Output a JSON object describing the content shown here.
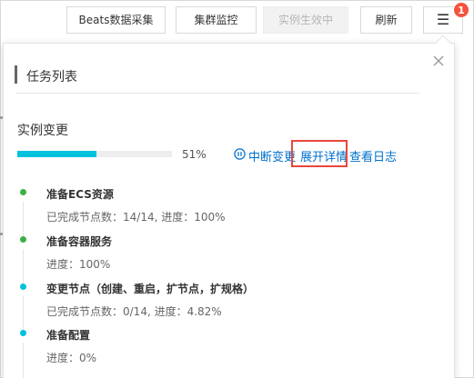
{
  "toolbar": {
    "beats_label": "Beats数据采集",
    "cluster_label": "集群监控",
    "effective_label": "实例生效中",
    "refresh_label": "刷新",
    "menu_glyph": "☰",
    "badge_count": "1"
  },
  "panel": {
    "title": "任务列表",
    "section_title": "实例变更",
    "progress": {
      "value": 51,
      "label": "51%"
    },
    "actions": {
      "pause_label": "中断变更",
      "expand_label": "展开详情",
      "logs_label": "查看日志"
    },
    "steps": [
      {
        "title": "准备ECS资源",
        "detail": "已完成节点数：14/14, 进度：100%",
        "status": "done"
      },
      {
        "title": "准备容器服务",
        "detail": "进度：100%",
        "status": "done"
      },
      {
        "title": "变更节点（创建、重启，扩节点，扩规格）",
        "detail": "已完成节点数：0/14, 进度：4.82%",
        "status": "active"
      },
      {
        "title": "准备配置",
        "detail": "进度：0%",
        "status": "active"
      }
    ]
  },
  "colors": {
    "done": "#3bb143",
    "active": "#00c1de",
    "link": "#0070cc",
    "highlight": "#e8473a",
    "badge": "#f5533d"
  },
  "icons": [
    "close-icon",
    "pause-circle-icon",
    "menu-icon"
  ]
}
